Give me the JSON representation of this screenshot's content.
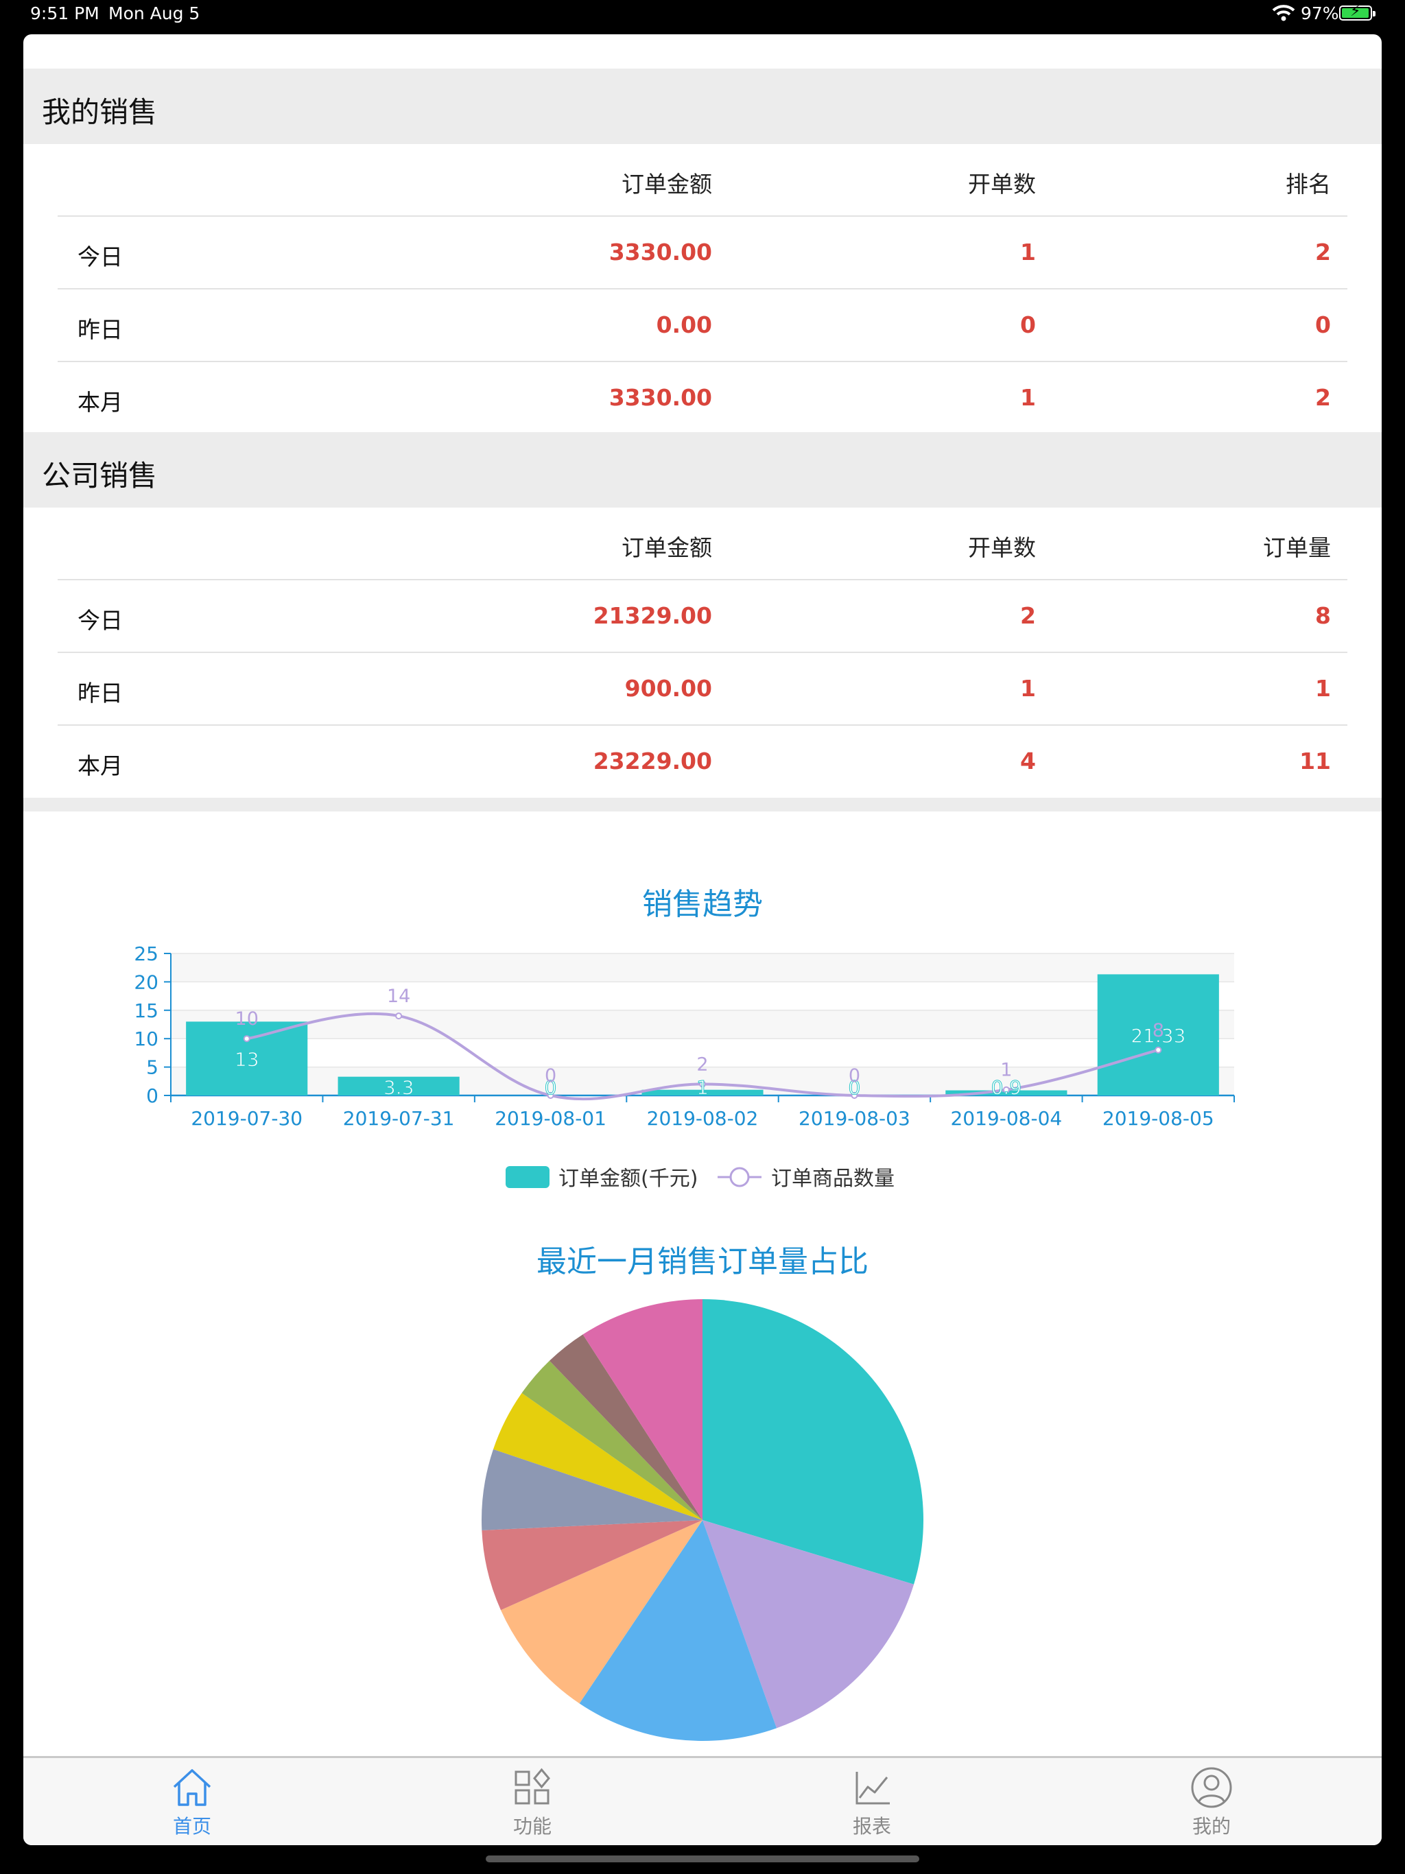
{
  "status_bar": {
    "time": "9:51 PM",
    "date": "Mon Aug 5",
    "battery": "97%",
    "battery_level": 0.97
  },
  "my_sales": {
    "title": "我的销售",
    "columns": [
      "订单金额",
      "开单数",
      "排名"
    ],
    "rows": [
      {
        "label": "今日",
        "values": [
          "3330.00",
          "1",
          "2"
        ]
      },
      {
        "label": "昨日",
        "values": [
          "0.00",
          "0",
          "0"
        ]
      },
      {
        "label": "本月",
        "values": [
          "3330.00",
          "1",
          "2"
        ]
      }
    ]
  },
  "company_sales": {
    "title": "公司销售",
    "columns": [
      "订单金额",
      "开单数",
      "订单量"
    ],
    "rows": [
      {
        "label": "今日",
        "values": [
          "21329.00",
          "2",
          "8"
        ]
      },
      {
        "label": "昨日",
        "values": [
          "900.00",
          "1",
          "1"
        ]
      },
      {
        "label": "本月",
        "values": [
          "23229.00",
          "4",
          "11"
        ]
      }
    ]
  },
  "chart_data": [
    {
      "type": "bar",
      "title": "销售趋势",
      "categories": [
        "2019-07-30",
        "2019-07-31",
        "2019-08-01",
        "2019-08-02",
        "2019-08-03",
        "2019-08-04",
        "2019-08-05"
      ],
      "series": [
        {
          "name": "订单金额(千元)",
          "type": "bar",
          "color": "#2ec7c9",
          "values": [
            13,
            3.3,
            0,
            1,
            0,
            0.9,
            21.33
          ]
        },
        {
          "name": "订单商品数量",
          "type": "line",
          "color": "#b6a2de",
          "values": [
            10,
            14,
            0,
            2,
            0,
            1,
            8
          ]
        }
      ],
      "ylim": [
        0,
        25
      ],
      "yticks": [
        0,
        5,
        10,
        15,
        20,
        25
      ],
      "legend": "bottom-center",
      "grid": true
    },
    {
      "type": "pie",
      "title": "最近一月销售订单量占比",
      "values": [
        30,
        15,
        15,
        9,
        6,
        6,
        4.6,
        3.1,
        3.1,
        9.2
      ],
      "colors": [
        "#2ec7c9",
        "#b6a2de",
        "#5ab1ef",
        "#ffb980",
        "#d87a80",
        "#8d98b3",
        "#e5cf0d",
        "#97b552",
        "#95706d",
        "#dc69aa"
      ]
    }
  ],
  "tabbar": {
    "items": [
      {
        "label": "首页",
        "icon": "home-icon",
        "active": true
      },
      {
        "label": "功能",
        "icon": "grid-icon",
        "active": false
      },
      {
        "label": "报表",
        "icon": "line-chart-icon",
        "active": false
      },
      {
        "label": "我的",
        "icon": "user-icon",
        "active": false
      }
    ],
    "active_color": "#3b8fe8",
    "inactive_color": "#888888"
  }
}
